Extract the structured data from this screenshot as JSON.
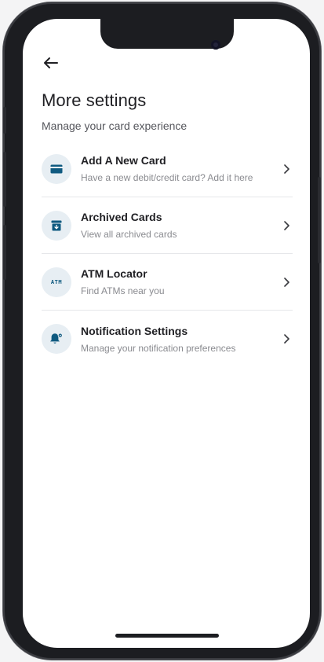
{
  "header": {
    "title": "More settings",
    "subtitle": "Manage your card experience"
  },
  "items": [
    {
      "title": "Add A New Card",
      "desc": "Have a new debit/credit card? Add it here",
      "icon": "card-icon"
    },
    {
      "title": "Archived Cards",
      "desc": "View all archived cards",
      "icon": "archive-icon"
    },
    {
      "title": "ATM Locator",
      "desc": "Find ATMs near you",
      "icon": "atm-icon",
      "icon_text": "ATM"
    },
    {
      "title": "Notification Settings",
      "desc": "Manage your notification preferences",
      "icon": "bell-gear-icon"
    }
  ],
  "colors": {
    "accent": "#0f5a80",
    "icon_bg": "#e7eef3",
    "title": "#1f1f23",
    "muted": "#8a8b90"
  }
}
